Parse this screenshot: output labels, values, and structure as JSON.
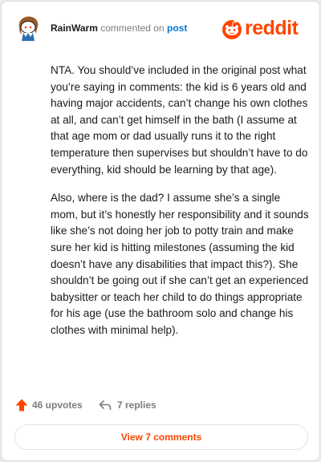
{
  "comment": {
    "username": "RainWarm",
    "action_text": "commented on",
    "post_link": "post",
    "paragraphs": [
      "NTA. You should’ve included in the original post what you’re saying in comments: the kid is 6 years old and having major accidents, can’t change his own clothes at all, and can’t get himself in the bath (I assume at that age mom or dad usually runs it to the right temperature then supervises but shouldn’t have to do everything, kid should be learning by that age).",
      "Also, where is the dad? I assume she’s a single mom, but it’s honestly her responsibility and it sounds like she’s not doing her job to potty train and make sure her kid is hitting milestones (assuming the kid doesn’t have any disabilities that impact this?). She shouldn’t be going out if she can’t get an experienced babysitter or teach her child to do things appropriate for his age (use the bathroom solo and change his clothes with minimal help)."
    ]
  },
  "brand": {
    "wordmark": "reddit",
    "color": "#ff4500"
  },
  "footer": {
    "upvotes": "46 upvotes",
    "replies": "7 replies",
    "view_button": "View 7 comments"
  },
  "icons": {
    "avatar": "snoo-avatar-icon",
    "brand": "reddit-logo-icon",
    "upvote": "upvote-arrow-icon",
    "reply": "reply-arrow-icon"
  }
}
